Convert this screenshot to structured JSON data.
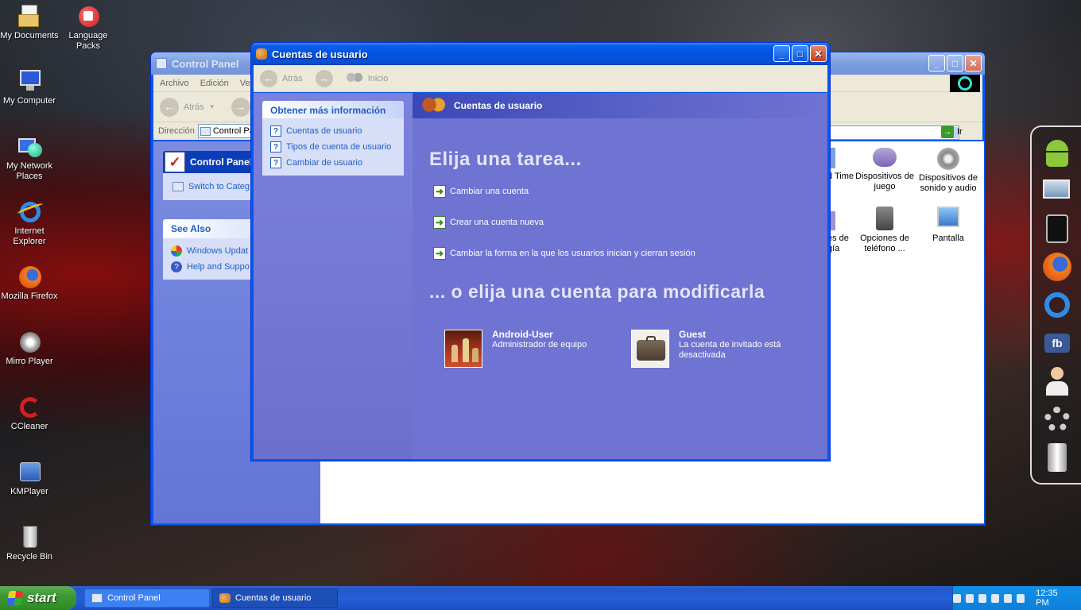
{
  "desktop": {
    "icons": [
      {
        "label": "My Documents",
        "icon": "my-documents-icon"
      },
      {
        "label": "Language Packs",
        "icon": "language-packs-icon"
      },
      {
        "label": "My Computer",
        "icon": "my-computer-icon"
      },
      {
        "label": "My Network Places",
        "icon": "network-places-icon"
      },
      {
        "label": "Internet Explorer",
        "icon": "internet-explorer-icon"
      },
      {
        "label": "Mozilla Firefox",
        "icon": "firefox-icon"
      },
      {
        "label": "Mirro Player",
        "icon": "mirro-player-icon"
      },
      {
        "label": "CCleaner",
        "icon": "ccleaner-icon"
      },
      {
        "label": "KMPlayer",
        "icon": "kmplayer-icon"
      },
      {
        "label": "Recycle Bin",
        "icon": "recycle-bin-icon"
      }
    ]
  },
  "control_panel": {
    "title": "Control Panel",
    "menu": [
      "Archivo",
      "Edición",
      "Ve"
    ],
    "back_label": "Atrás",
    "address_label": "Dirección",
    "address_value": "Control Pa",
    "go_label": "Ir",
    "sidebar_title": "Control Panel",
    "switch_label": "Switch to Categ",
    "see_also_title": "See Also",
    "see_also_items": [
      "Windows Updat",
      "Help and Suppo"
    ],
    "items": [
      {
        "label": "d Time"
      },
      {
        "label": "Dispositivos de juego"
      },
      {
        "label": "Dispositivos de sonido y audio"
      },
      {
        "label": "es de gía"
      },
      {
        "label": "Opciones de teléfono ..."
      },
      {
        "label": "Pantalla"
      }
    ]
  },
  "user_accounts": {
    "title": "Cuentas de usuario",
    "back_label": "Atrás",
    "home_label": "Inicio",
    "header_title": "Cuentas de usuario",
    "sidebar_title": "Obtener más información",
    "sidebar_items": [
      "Cuentas de usuario",
      "Tipos de cuenta de usuario",
      "Cambiar de usuario"
    ],
    "task_heading": "Elija una tarea...",
    "tasks": [
      "Cambiar una cuenta",
      "Crear una cuenta nueva",
      "Cambiar la forma en la que los usuarios inician y cierran sesión"
    ],
    "account_heading": "... o elija una cuenta para modificarla",
    "accounts": [
      {
        "name": "Android-User",
        "desc": "Administrador de equipo"
      },
      {
        "name": "Guest",
        "desc": "La cuenta de invitado está desactivada"
      }
    ]
  },
  "taskbar": {
    "start_label": "start",
    "tasks": [
      "Control Panel",
      "Cuentas de usuario"
    ],
    "clock": "12:35 PM"
  },
  "colors": {
    "xp_blue": "#0058ee",
    "task_pane": "#6f73d2",
    "start_green": "#3c9a32"
  }
}
